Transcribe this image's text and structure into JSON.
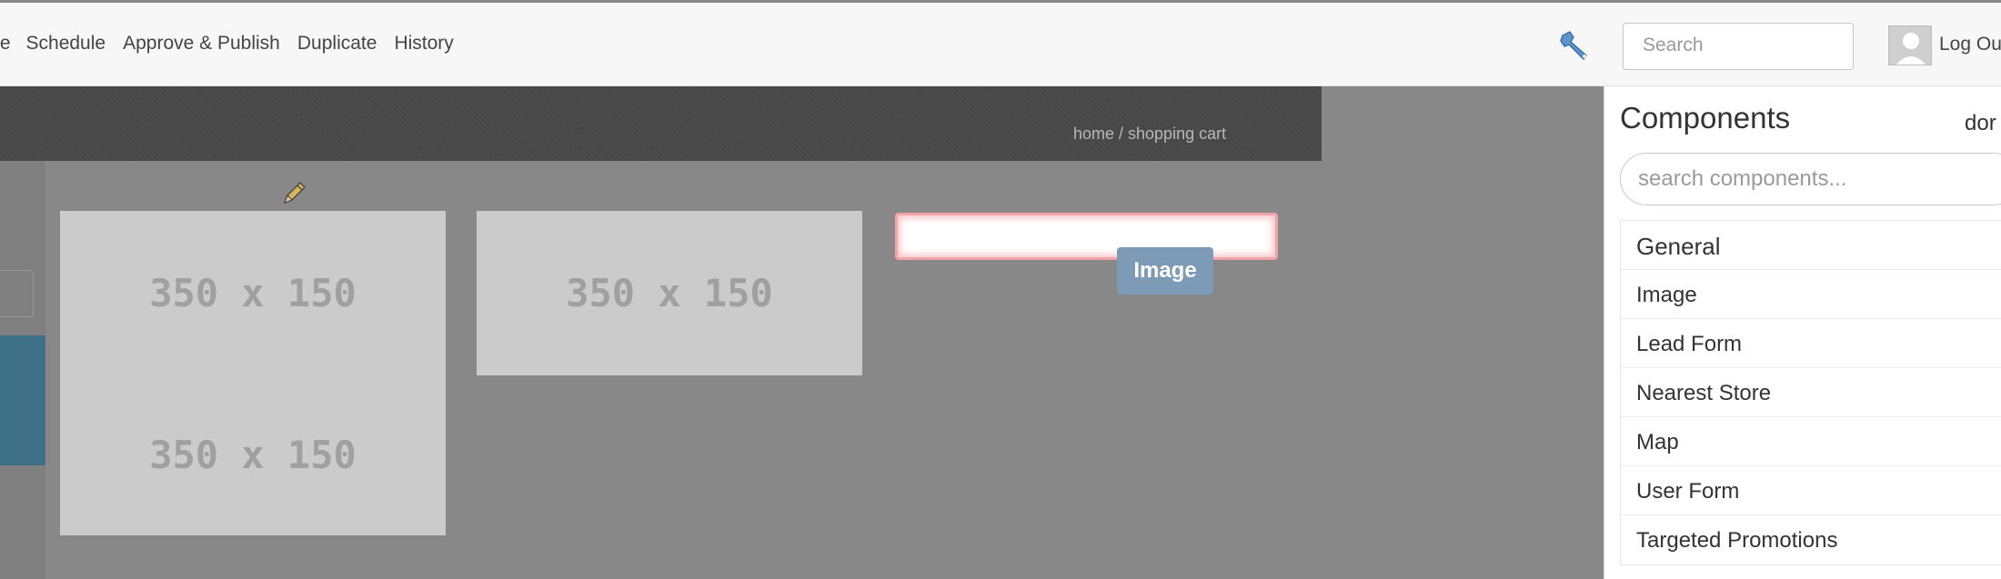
{
  "toolbar": {
    "nav": [
      "te",
      "Schedule",
      "Approve & Publish",
      "Duplicate",
      "History"
    ],
    "search_placeholder": "Search",
    "logout_label": "Log Ou"
  },
  "canvas": {
    "breadcrumb": "home / shopping cart",
    "placeholders": [
      "350 x 150",
      "350 x 150",
      "350 x 150"
    ],
    "drag_chip_label": "Image"
  },
  "panel": {
    "title": "Components",
    "done_label": "dor",
    "search_placeholder": "search components...",
    "heading": "General",
    "items": [
      "Image",
      "Lead Form",
      "Nearest Store",
      "Map",
      "User Form",
      "Targeted Promotions"
    ]
  },
  "icons": {
    "tools": "wrench-icon",
    "user": "avatar-icon",
    "edit": "pencil-icon"
  },
  "colors": {
    "accent_blue": "#3d6f86",
    "drag_chip": "#7d9ab7",
    "drop_highlight": "#f2a4aa"
  }
}
